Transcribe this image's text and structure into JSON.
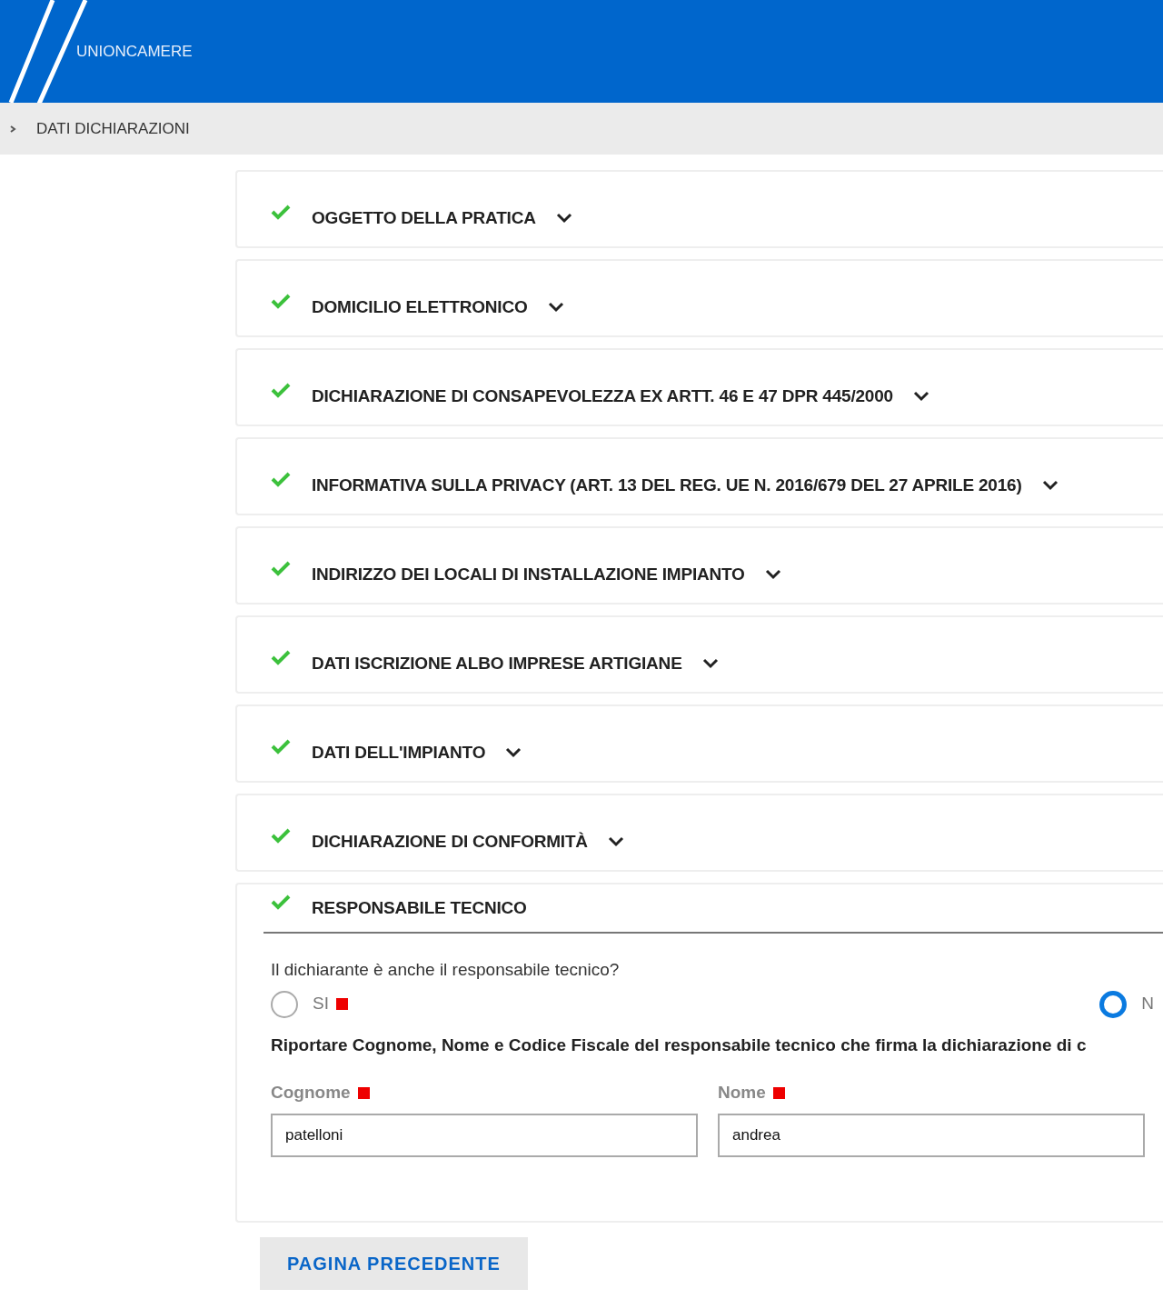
{
  "header": {
    "brand": "UNIONCAMERE"
  },
  "breadcrumb": {
    "label": "DATI DICHIARAZIONI"
  },
  "sections": [
    {
      "title": "OGGETTO DELLA PRATICA",
      "complete": true,
      "expanded": false
    },
    {
      "title": "DOMICILIO ELETTRONICO",
      "complete": true,
      "expanded": false
    },
    {
      "title": "DICHIARAZIONE DI CONSAPEVOLEZZA EX ARTT. 46 E 47 DPR 445/2000",
      "complete": true,
      "expanded": false
    },
    {
      "title": "INFORMATIVA SULLA PRIVACY (ART. 13 DEL REG. UE N. 2016/679 DEL 27 APRILE 2016)",
      "complete": true,
      "expanded": false
    },
    {
      "title": "INDIRIZZO DEI LOCALI DI INSTALLAZIONE IMPIANTO",
      "complete": true,
      "expanded": false
    },
    {
      "title": "DATI ISCRIZIONE ALBO IMPRESE ARTIGIANE",
      "complete": true,
      "expanded": false
    },
    {
      "title": "DATI DELL'IMPIANTO",
      "complete": true,
      "expanded": false
    },
    {
      "title": "DICHIARAZIONE DI CONFORMITÀ",
      "complete": true,
      "expanded": false
    },
    {
      "title": "RESPONSABILE TECNICO",
      "complete": true,
      "expanded": true
    }
  ],
  "form": {
    "question": "Il dichiarante è anche il responsabile tecnico?",
    "options": [
      {
        "label": "SI",
        "required": true,
        "selected": false
      },
      {
        "label": "N",
        "selected": true
      }
    ],
    "instruction": "Riportare Cognome, Nome e Codice Fiscale del responsabile tecnico che firma la dichiarazione di c",
    "fields": [
      {
        "label": "Cognome",
        "required": true,
        "value": "patelloni"
      },
      {
        "label": "Nome",
        "required": true,
        "value": "andrea"
      }
    ]
  },
  "buttons": [
    {
      "label": "PAGINA PRECEDENTE"
    }
  ]
}
